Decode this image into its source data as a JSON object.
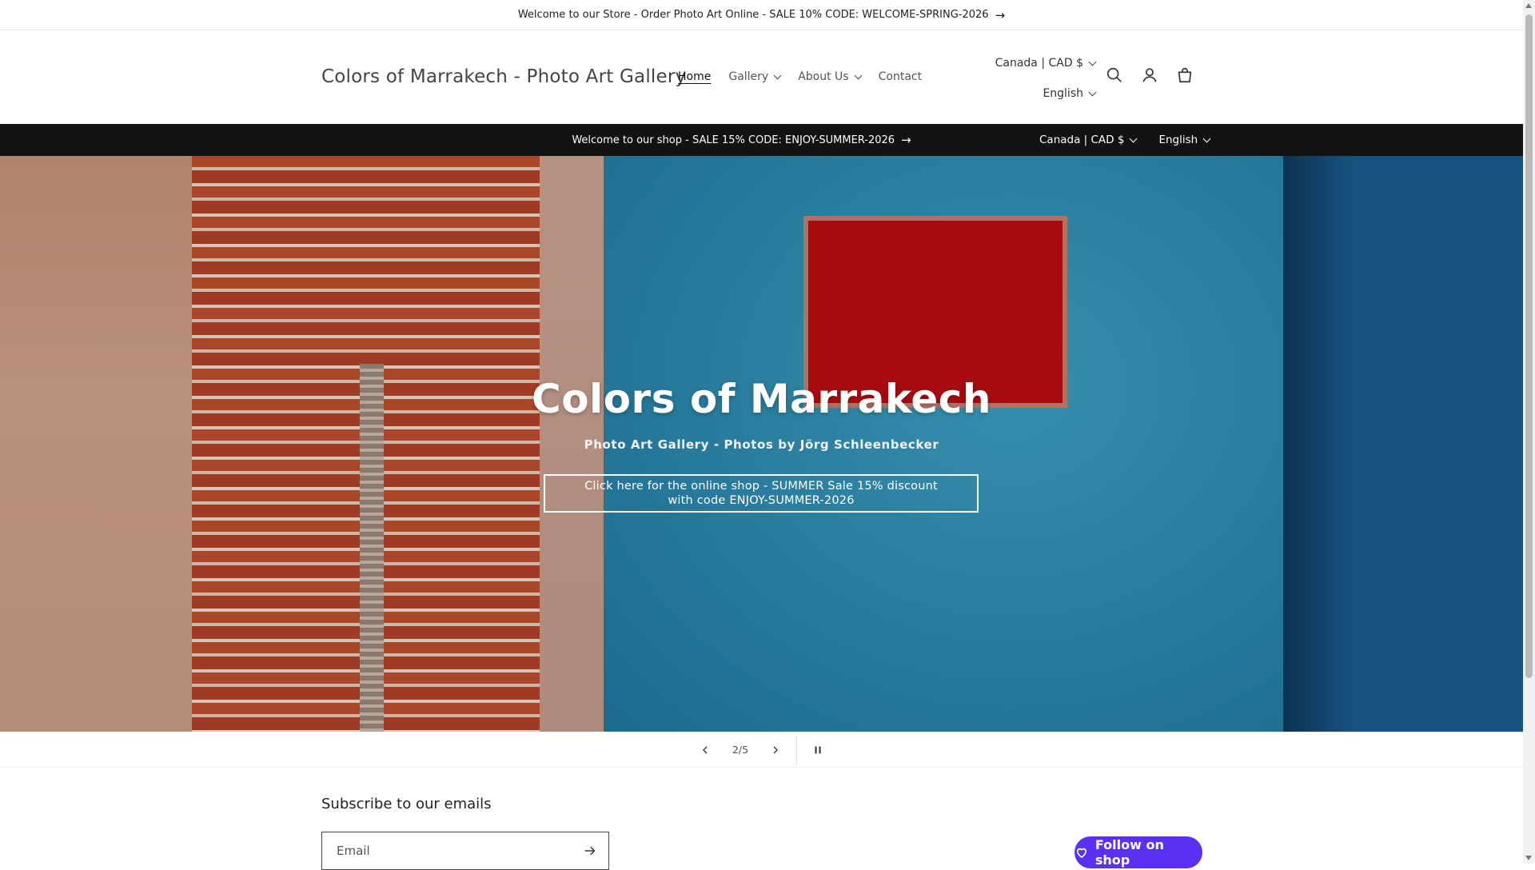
{
  "announcement_top": {
    "text": "Welcome to our Store - Order Photo Art Online - SALE 10% CODE: WELCOME-SPRING-2026",
    "arrow": "→"
  },
  "header": {
    "logo": "Colors of Marrakech - Photo Art Gallery",
    "nav": [
      {
        "label": "Home",
        "active": true
      },
      {
        "label": "Gallery",
        "has_dropdown": true
      },
      {
        "label": "About Us",
        "has_dropdown": true
      },
      {
        "label": "Contact"
      }
    ],
    "localization": {
      "country": "Canada | CAD $",
      "language": "English"
    },
    "icons": [
      "search-icon",
      "account-icon",
      "cart-icon"
    ]
  },
  "announcement_dark": {
    "text": "Welcome to our shop - SALE 15% CODE: ENJOY-SUMMER-2026",
    "arrow": "→",
    "country": "Canada | CAD $",
    "language": "English"
  },
  "hero": {
    "title": "Colors of Marrakech",
    "subtitle": "Photo Art Gallery - Photos by Jörg Schleenbecker",
    "cta": "Click here for the online shop - SUMMER Sale 15% discount with code ENJOY-SUMMER-2026"
  },
  "slider": {
    "counter": "2/5"
  },
  "newsletter": {
    "heading": "Subscribe to our emails",
    "email_placeholder": "Email"
  },
  "follow": {
    "label": "Follow on shop",
    "color": "#5a31f4"
  }
}
